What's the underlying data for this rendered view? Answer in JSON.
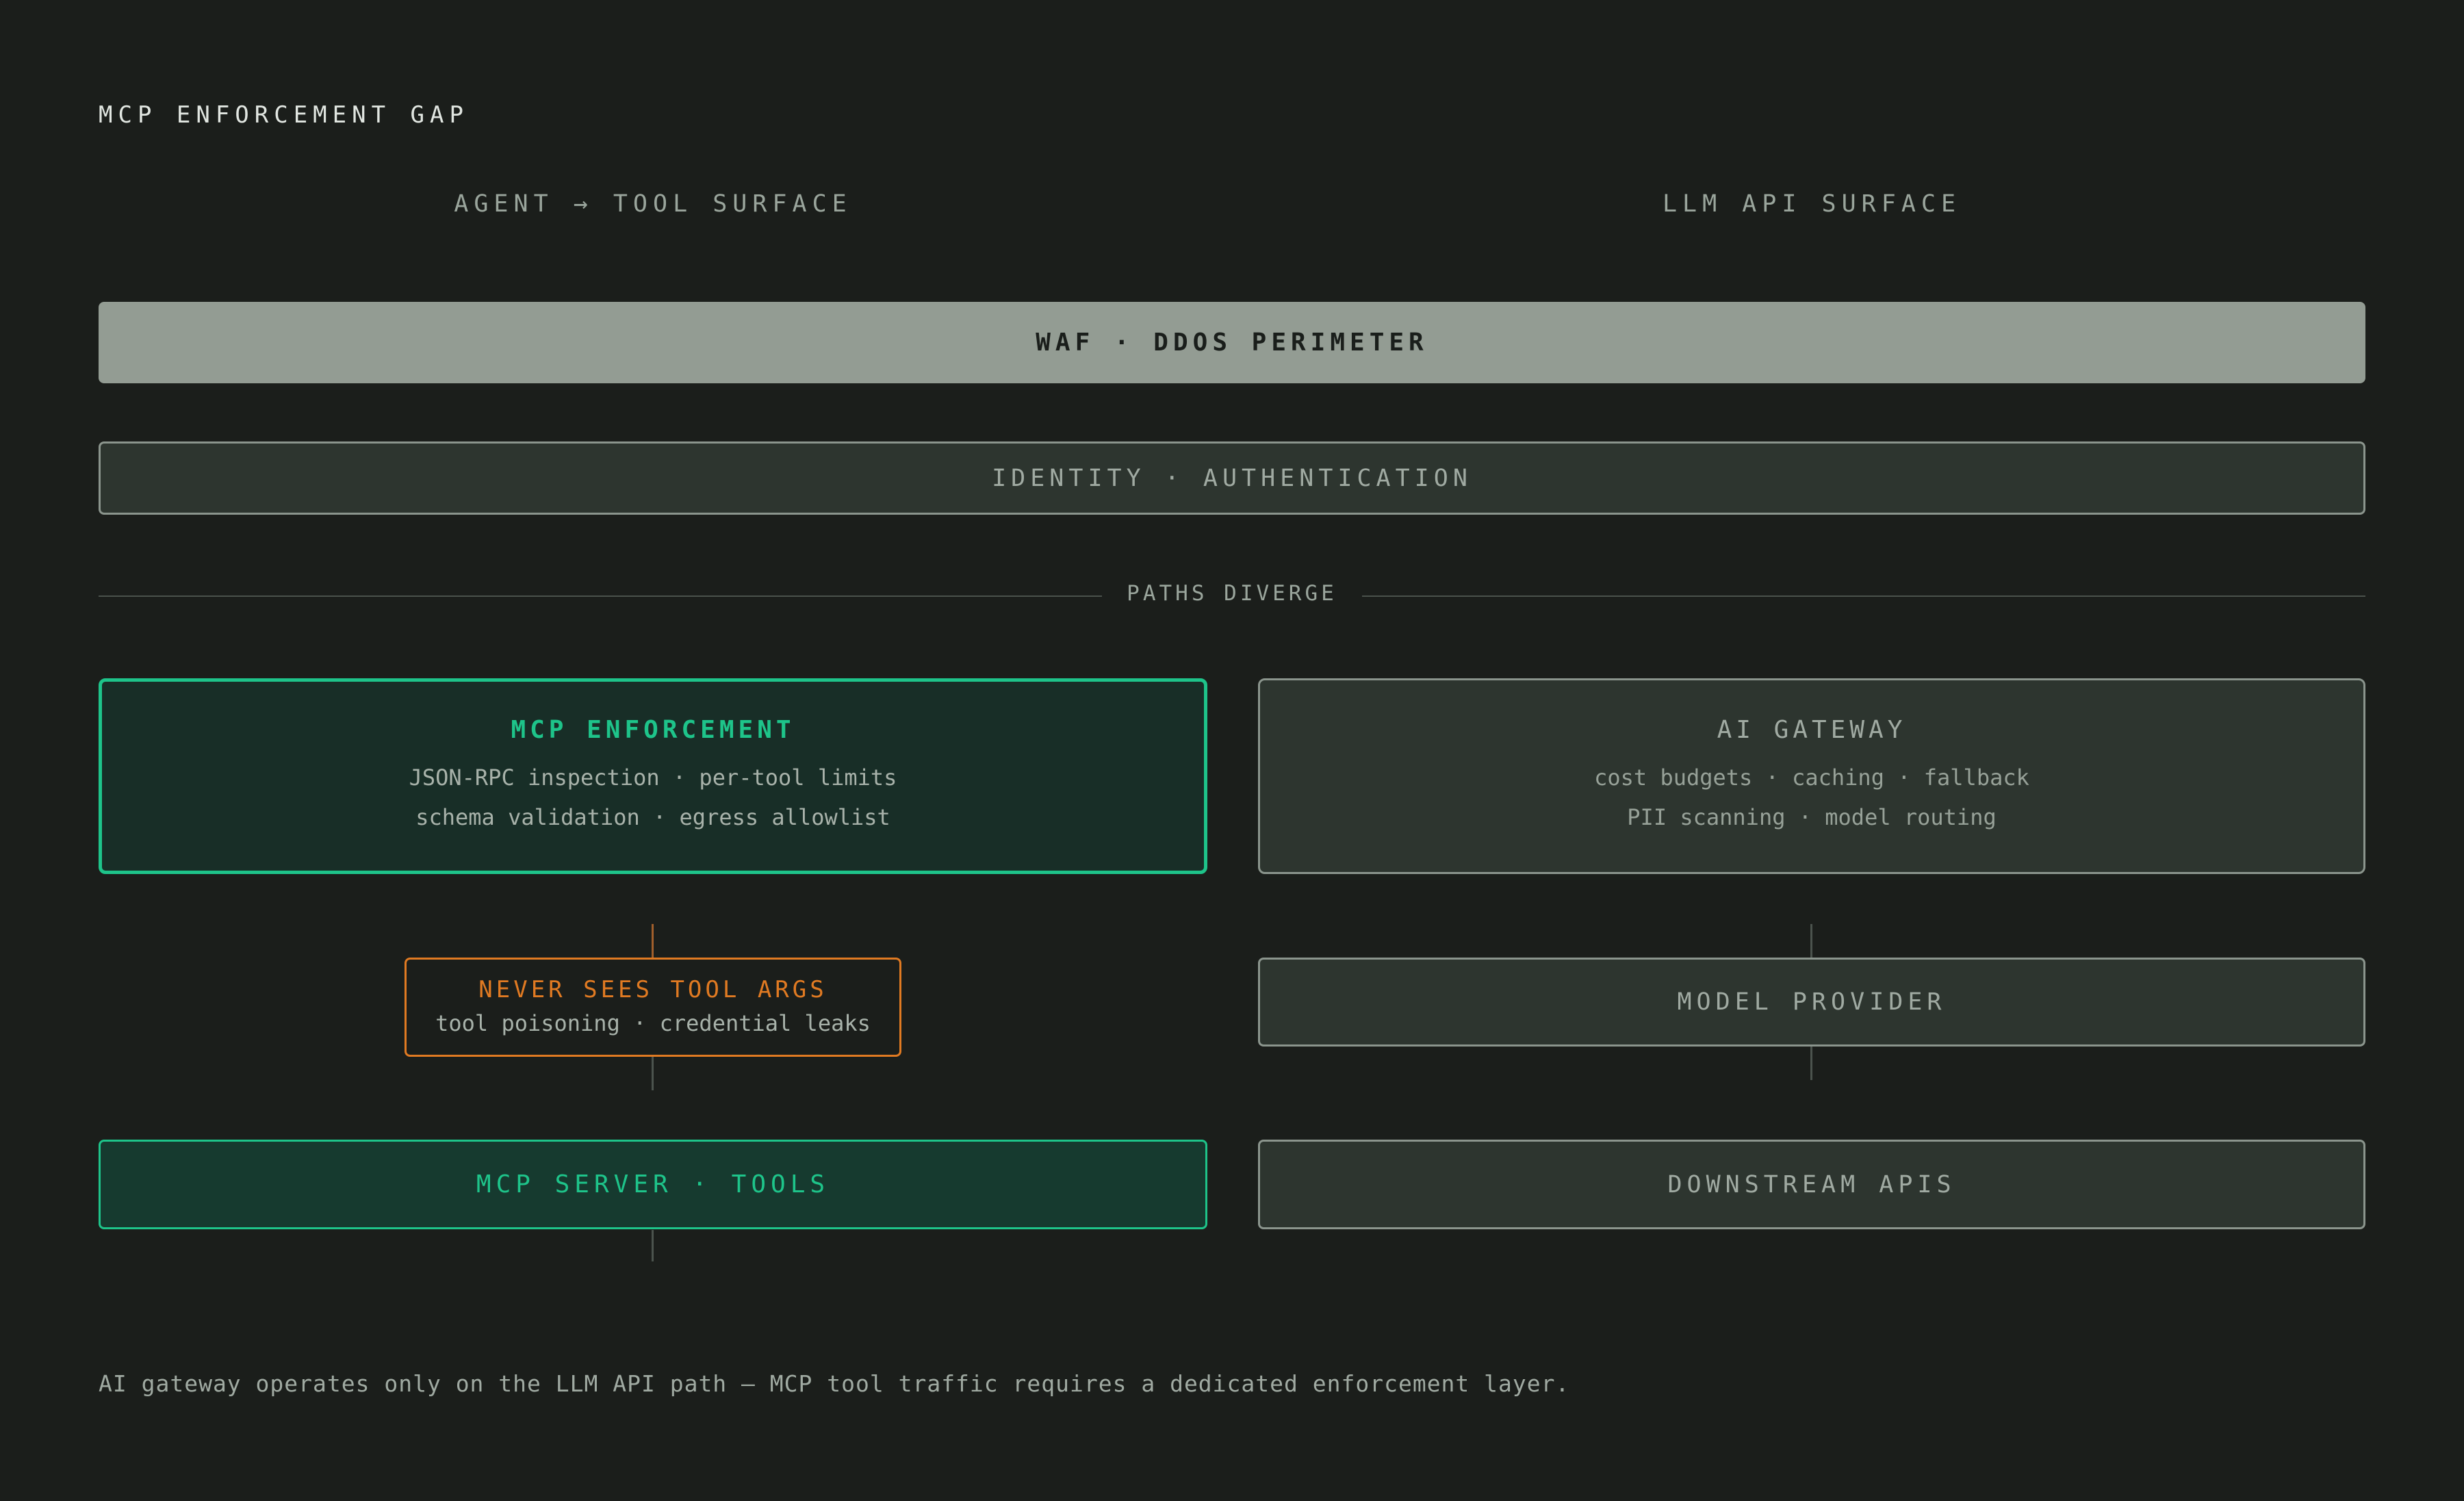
{
  "title": "MCP ENFORCEMENT GAP",
  "columns": {
    "left": "AGENT → TOOL SURFACE",
    "right": "LLM API SURFACE"
  },
  "perimeter": "WAF · DDOS PERIMETER",
  "identity": "IDENTITY · AUTHENTICATION",
  "divider": "PATHS DIVERGE",
  "mcp_enforcement": {
    "title": "MCP ENFORCEMENT",
    "line1": "JSON-RPC inspection · per-tool limits",
    "line2": "schema validation · egress allowlist"
  },
  "ai_gateway": {
    "title": "AI GATEWAY",
    "line1": "cost budgets · caching · fallback",
    "line2": "PII scanning · model routing"
  },
  "warning": {
    "title": "NEVER SEES TOOL ARGS",
    "line1": "tool poisoning · credential leaks"
  },
  "model_provider": "MODEL PROVIDER",
  "mcp_server": "MCP SERVER · TOOLS",
  "downstream": "DOWNSTREAM APIS",
  "footer": "AI gateway operates only on the LLM API path — MCP tool traffic requires a dedicated enforcement layer.",
  "colors": {
    "background": "#1b1e1b",
    "accent_green": "#1ec48a",
    "warning_orange": "#e07a22",
    "neutral_box": "#2d352f",
    "perimeter_fill": "#939c93"
  }
}
